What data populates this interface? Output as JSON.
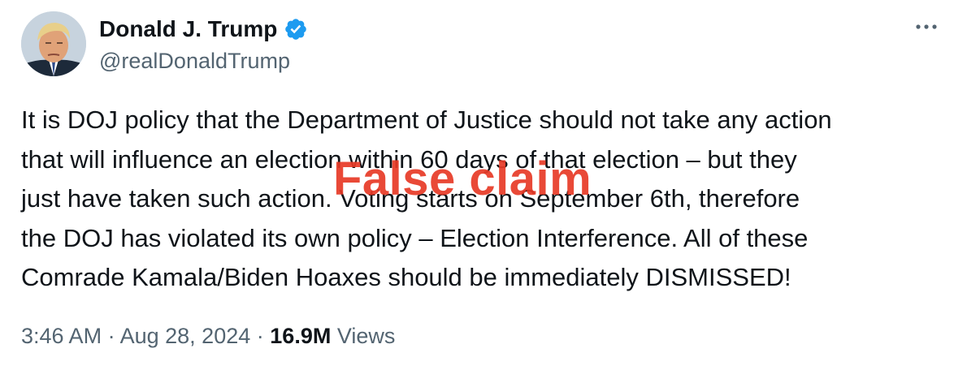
{
  "author": {
    "display_name": "Donald J. Trump",
    "handle": "@realDonaldTrump",
    "verified_icon": "verified-badge-icon",
    "avatar_icon": "avatar-portrait"
  },
  "tweet": {
    "lines": [
      "It is DOJ policy that the Department of Justice should not take any action",
      "that will influence an election within 60 days of that election – but they",
      "just have taken such action. Voting starts on September 6th, therefore",
      "the DOJ has violated its own policy – Election Interference. All of these",
      "Comrade Kamala/Biden Hoaxes should be immediately DISMISSED!"
    ]
  },
  "overlay": {
    "label": "False claim",
    "color": "#e73a26"
  },
  "meta": {
    "time": "3:46 AM",
    "separator": "·",
    "date": "Aug 28, 2024",
    "views_count": "16.9M",
    "views_label": "Views"
  },
  "colors": {
    "verified": "#1d9bf0",
    "secondary_text": "#536471",
    "primary_text": "#0f1419"
  },
  "icons": {
    "more": "more-horizontal-icon"
  }
}
